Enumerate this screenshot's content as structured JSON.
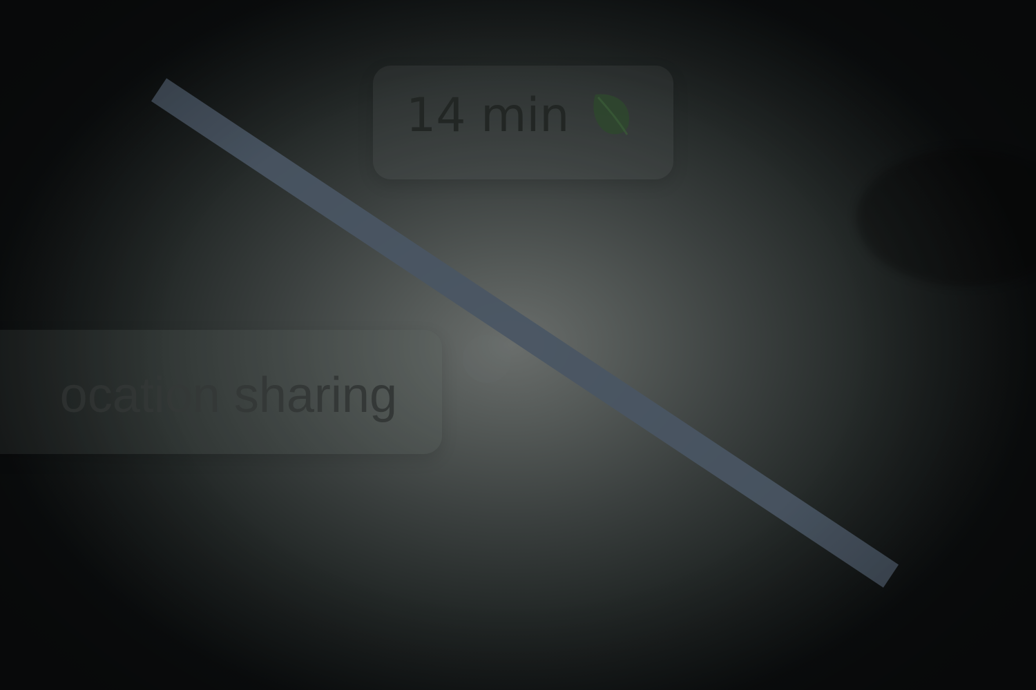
{
  "eta": {
    "label": "14 min",
    "eco_icon": "leaf-icon",
    "eco_color": "#2e4a2c"
  },
  "share": {
    "label": "ocation sharing"
  },
  "map": {
    "route_color": "#4a5664",
    "background_color": "#0d0f10"
  }
}
